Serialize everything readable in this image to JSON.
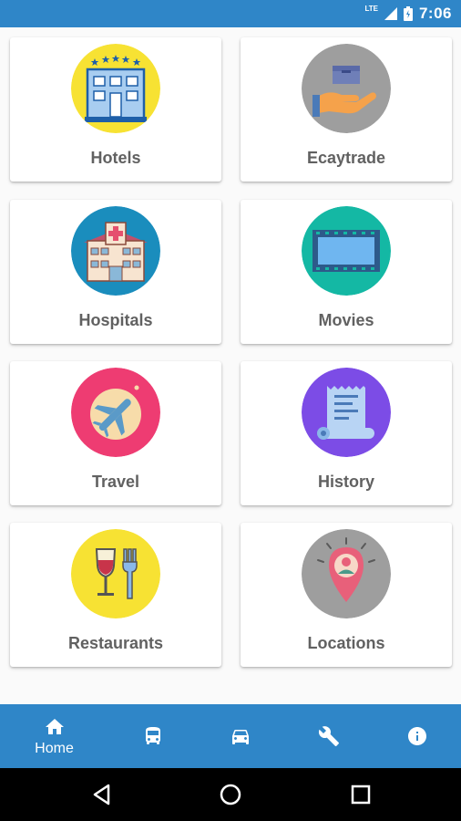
{
  "status_bar": {
    "network": "LTE",
    "time": "7:06"
  },
  "cards": [
    {
      "label": "Hotels",
      "icon": "hotel-icon",
      "bg": "#f7e233"
    },
    {
      "label": "Ecaytrade",
      "icon": "trade-icon",
      "bg": "#9e9e9e"
    },
    {
      "label": "Hospitals",
      "icon": "hospital-icon",
      "bg": "#1a8dbd"
    },
    {
      "label": "Movies",
      "icon": "film-icon",
      "bg": "#14b8a4"
    },
    {
      "label": "Travel",
      "icon": "airplane-icon",
      "bg": "#ee3c72"
    },
    {
      "label": "History",
      "icon": "scroll-icon",
      "bg": "#7c4ce6"
    },
    {
      "label": "Restaurants",
      "icon": "wine-fork-icon",
      "bg": "#f7e233"
    },
    {
      "label": "Locations",
      "icon": "location-pin-icon",
      "bg": "#9e9e9e"
    }
  ],
  "bottom_nav": {
    "active": "home",
    "items": [
      {
        "id": "home",
        "label": "Home",
        "icon": "home-icon"
      },
      {
        "id": "bus",
        "label": "",
        "icon": "bus-icon"
      },
      {
        "id": "taxi",
        "label": "",
        "icon": "car-icon"
      },
      {
        "id": "services",
        "label": "",
        "icon": "wrench-icon"
      },
      {
        "id": "info",
        "label": "",
        "icon": "info-icon"
      }
    ]
  },
  "colors": {
    "primary": "#2f86c8",
    "card_text": "#616161",
    "background": "#fafafa"
  }
}
